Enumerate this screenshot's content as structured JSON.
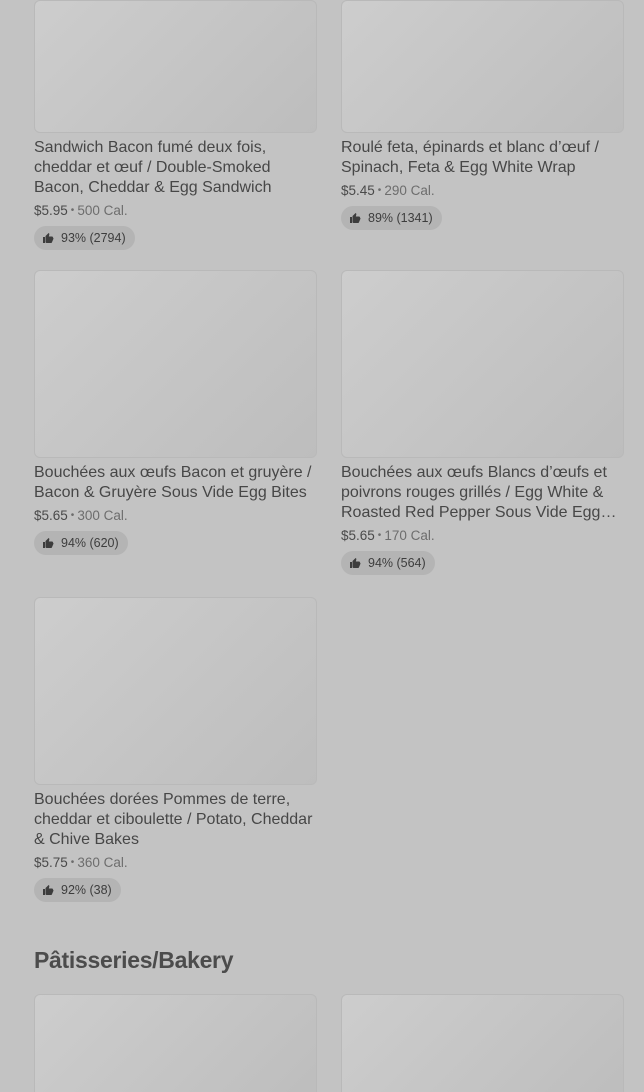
{
  "items": [
    {
      "title": "Sandwich Bacon fumé deux fois, cheddar et œuf / Double-Smoked Bacon, Cheddar & Egg Sandwich",
      "price": "$5.95",
      "calories": "500 Cal.",
      "rating": "93% (2794)",
      "icon": "thumbs-up-icon"
    },
    {
      "title": "Roulé feta, épinards et blanc d’œuf / Spinach, Feta & Egg White Wrap",
      "price": "$5.45",
      "calories": "290 Cal.",
      "rating": "89% (1341)",
      "icon": "thumbs-up-icon"
    },
    {
      "title": "Bouchées aux œufs Bacon et gruyère / Bacon & Gruyère Sous Vide Egg Bites",
      "price": "$5.65",
      "calories": "300 Cal.",
      "rating": "94% (620)",
      "icon": "thumbs-up-icon"
    },
    {
      "title": "Bouchées aux œufs Blancs d’œufs et poivrons rouges grillés / Egg White & Roasted Red Pepper Sous Vide Egg Bites",
      "price": "$5.65",
      "calories": "170 Cal.",
      "rating": "94% (564)",
      "icon": "thumbs-up-icon"
    },
    {
      "title": "Bouchées dorées Pommes de terre, cheddar et ciboulette / Potato, Cheddar & Chive Bakes",
      "price": "$5.75",
      "calories": "360 Cal.",
      "rating": "92% (38)",
      "icon": "thumbs-up-icon"
    }
  ],
  "section": {
    "title": "Pâtisseries/Bakery"
  },
  "colors": {
    "overlay_bg": "#c3c3c3",
    "placeholder": "#c8c8c8",
    "pill": "#b4b4b4"
  }
}
